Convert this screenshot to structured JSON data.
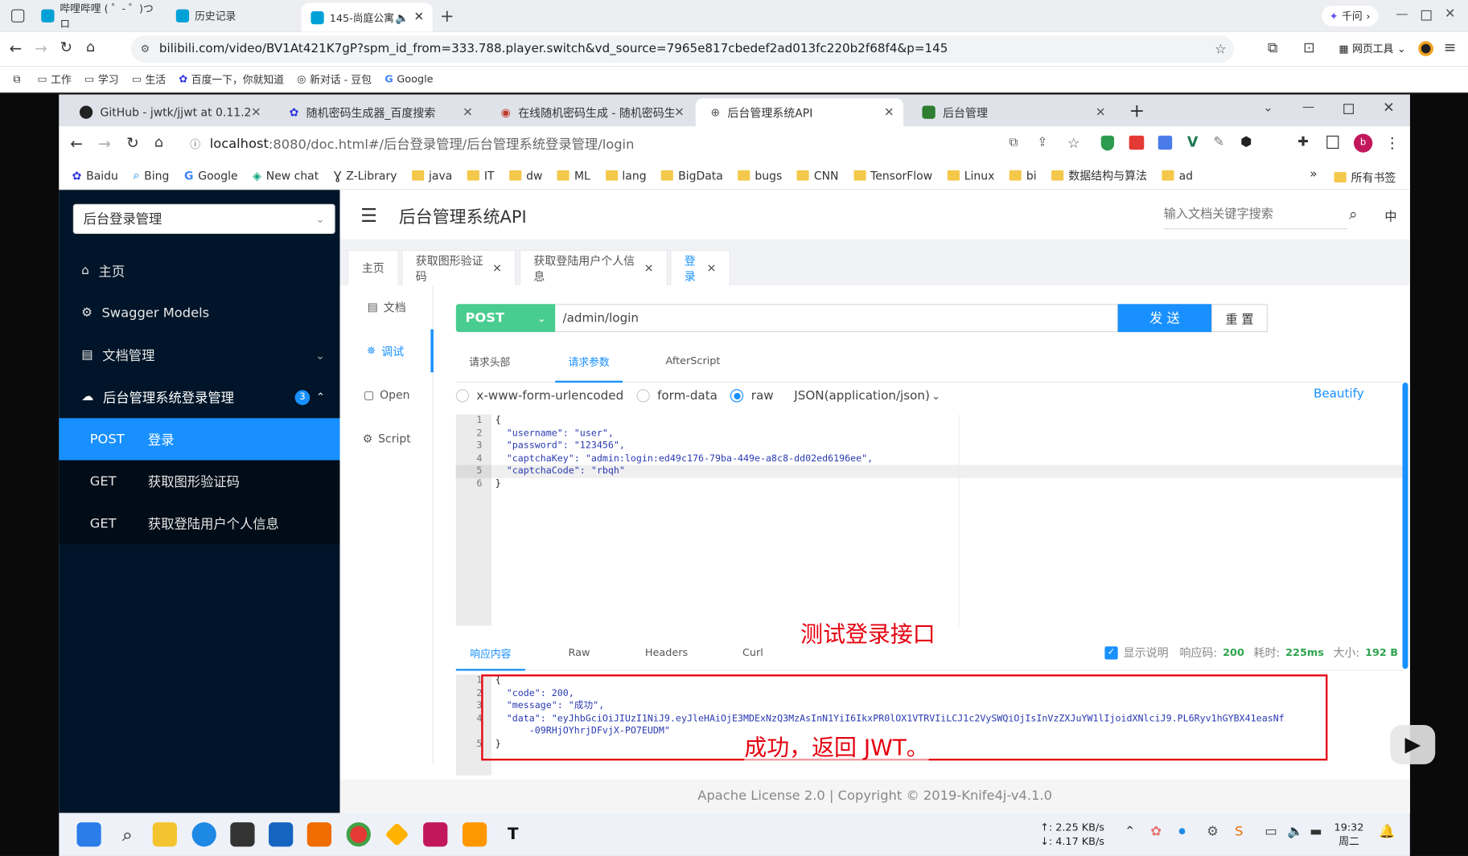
{
  "outer_browser": {
    "tabs": [
      {
        "title": "哔哩哔哩 ( ゜- ゜)つロ"
      },
      {
        "title": "历史记录"
      },
      {
        "title": "145-尚庭公寓"
      }
    ],
    "qianwen_label": "千问",
    "url": "bilibili.com/video/BV1At421K7gP?spm_id_from=333.788.player.switch&vd_source=7965e817cbedef2ad013fc220b2f68f4&p=145",
    "web_tools_label": "网页工具",
    "bookmarks": [
      "工作",
      "学习",
      "生活",
      "百度一下，你就知道",
      "新对话 - 豆包",
      "Google"
    ]
  },
  "inner_browser": {
    "tabs": [
      {
        "title": "GitHub - jwtk/jjwt at 0.11.2"
      },
      {
        "title": "随机密码生成器_百度搜索"
      },
      {
        "title": "在线随机密码生成 - 随机密码生"
      },
      {
        "title": "后台管理系统API"
      },
      {
        "title": "后台管理"
      }
    ],
    "url_host": "localhost",
    "url_rest": ":8080/doc.html#/后台登录管理/后台管理系统登录管理/login",
    "bookmarks": [
      "Baidu",
      "Bing",
      "Google",
      "New chat",
      "Z-Library",
      "java",
      "IT",
      "dw",
      "ML",
      "lang",
      "BigData",
      "bugs",
      "CNN",
      "TensorFlow",
      "Linux",
      "bi",
      "数据结构与算法",
      "ad"
    ],
    "more": "»",
    "all_bookmarks": "所有书签"
  },
  "sidebar": {
    "group_select": "后台登录管理",
    "items": [
      {
        "label": "主页"
      },
      {
        "label": "Swagger Models"
      },
      {
        "label": "文档管理"
      },
      {
        "label": "后台管理系统登录管理",
        "badge": "3"
      }
    ],
    "sub_items": [
      {
        "method": "POST",
        "label": "登录"
      },
      {
        "method": "GET",
        "label": "获取图形验证码"
      },
      {
        "method": "GET",
        "label": "获取登陆用户个人信息"
      }
    ]
  },
  "header": {
    "title": "后台管理系统API",
    "search_placeholder": "输入文档关键字搜索",
    "lang": "中"
  },
  "doc_tabs": [
    {
      "label": "主页"
    },
    {
      "label": "获取图形验证码"
    },
    {
      "label": "获取登陆用户个人信息"
    },
    {
      "label": "登录"
    }
  ],
  "left_menu": [
    "文档",
    "调试",
    "Open",
    "Script"
  ],
  "request": {
    "method": "POST",
    "path": "/admin/login",
    "send_label": "发 送",
    "reset_label": "重 置",
    "tabs": [
      "请求头部",
      "请求参数",
      "AfterScript"
    ],
    "body_types": [
      "x-www-form-urlencoded",
      "form-data",
      "raw"
    ],
    "content_type": "JSON(application/json)",
    "beautify": "Beautify",
    "line_numbers": [
      "1",
      "2",
      "3",
      "4",
      "5",
      "6"
    ],
    "body_lines": [
      "{",
      "  \"username\": \"user\",",
      "  \"password\": \"123456\",",
      "  \"captchaKey\": \"admin:login:ed49c176-79ba-449e-a8c8-dd02ed6196ee\",",
      "  \"captchaCode\": \"rbqh\"",
      "}"
    ]
  },
  "annotations": {
    "test_login": "测试登录接口",
    "success_jwt": "成功，返回 JWT。"
  },
  "response": {
    "tabs": [
      "响应内容",
      "Raw",
      "Headers",
      "Curl"
    ],
    "show_desc": "显示说明",
    "code_label": "响应码:",
    "code_value": "200",
    "time_label": "耗时:",
    "time_value": "225ms",
    "size_label": "大小:",
    "size_value": "192 B",
    "line_numbers": [
      "1",
      "2",
      "3",
      "4",
      "",
      "5"
    ],
    "body_lines": [
      "{",
      "  \"code\": 200,",
      "  \"message\": \"成功\",",
      "  \"data\": \"eyJhbGciOiJIUzI1NiJ9.eyJleHAiOjE3MDExNzQ3MzAsInN1YiI6IkxPR0lOX1VTRVIiLCJ1c2VySWQiOjIsInVzZXJuYW1lIjoidXNlciJ9.PL6Ryv1hGYBX41easNf",
      "      -09RHjOYhrjDFvjX-PO7EUDM\"",
      "}"
    ]
  },
  "footer": "Apache License 2.0 | Copyright © 2019-Knife4j-v4.1.0",
  "taskbar": {
    "net_up": "↑: 2.25 KB/s",
    "net_down": "↓: 4.17 KB/s",
    "time": "19:32",
    "day": "周二"
  },
  "colors": {
    "sidebar_bg": "#001529",
    "primary": "#1890ff",
    "post_green": "#49cc90",
    "annotation_red": "#e5000f"
  }
}
